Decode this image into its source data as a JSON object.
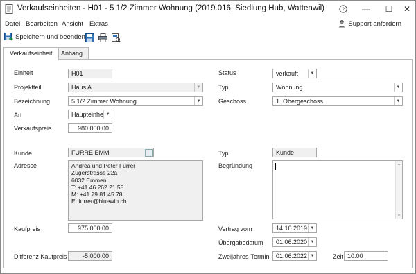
{
  "window": {
    "title": "Verkaufseinheiten - H01 - 5 1/2 Zimmer Wohnung (2019.016, Siedlung Hub, Wattenwil)",
    "controls": {
      "help": "?",
      "minimize": "—",
      "maximize": "☐",
      "close": "✕"
    }
  },
  "menu": {
    "items": [
      "Datei",
      "Bearbeiten",
      "Ansicht",
      "Extras"
    ],
    "support_label": "Support anfordern"
  },
  "toolbar": {
    "save_close_label": "Speichern und beenden"
  },
  "tabs": [
    {
      "label": "Verkaufseinheit",
      "active": true
    },
    {
      "label": "Anhang",
      "active": false
    }
  ],
  "form": {
    "einheit": {
      "label": "Einheit",
      "value": "H01"
    },
    "projektteil": {
      "label": "Projektteil",
      "value": "Haus A"
    },
    "bezeichnung": {
      "label": "Bezeichnung",
      "value": "5 1/2 Zimmer Wohnung"
    },
    "art": {
      "label": "Art",
      "value": "Haupteinheit"
    },
    "verkaufspreis": {
      "label": "Verkaufspreis",
      "value": "980 000.00"
    },
    "status": {
      "label": "Status",
      "value": "verkauft"
    },
    "typ": {
      "label": "Typ",
      "value": "Wohnung"
    },
    "geschoss": {
      "label": "Geschoss",
      "value": "1. Obergeschoss"
    },
    "kunde": {
      "label": "Kunde",
      "value": "FURRE EMM"
    },
    "adresse": {
      "label": "Adresse",
      "lines": [
        "Andrea und Peter Furrer",
        "Zugerstrasse 22a",
        "6032 Emmen",
        "T: +41 46 262 21 58",
        "M: +41 79 81 45 78",
        "E: furrer@bluewin.ch"
      ]
    },
    "kunde_typ": {
      "label": "Typ",
      "value": "Kunde"
    },
    "begruendung": {
      "label": "Begründung",
      "value": ""
    },
    "kaufpreis": {
      "label": "Kaufpreis",
      "value": "975 000.00"
    },
    "vertrag_vom": {
      "label": "Vertrag vom",
      "value": "14.10.2019"
    },
    "uebergabedatum": {
      "label": "Übergabedatum",
      "value": "01.06.2020"
    },
    "zweijahres_termin": {
      "label": "Zweijahres-Termin",
      "value": "01.06.2022"
    },
    "zeit": {
      "label": "Zeit",
      "value": "10:00"
    },
    "differenz_kaufpreis": {
      "label": "Differenz Kaufpreis",
      "value": "-5 000.00"
    }
  },
  "icons": {
    "app": "document-icon",
    "support": "support-person-icon",
    "save_close": "save-close-icon",
    "save": "floppy-disk-icon",
    "print": "printer-icon",
    "print_preview": "print-preview-icon",
    "dropdown": "chevron-down-icon"
  },
  "colors": {
    "accent": "#1f5fa8",
    "readonly_bg": "#f0f0f0",
    "border": "#a8a8a8"
  }
}
